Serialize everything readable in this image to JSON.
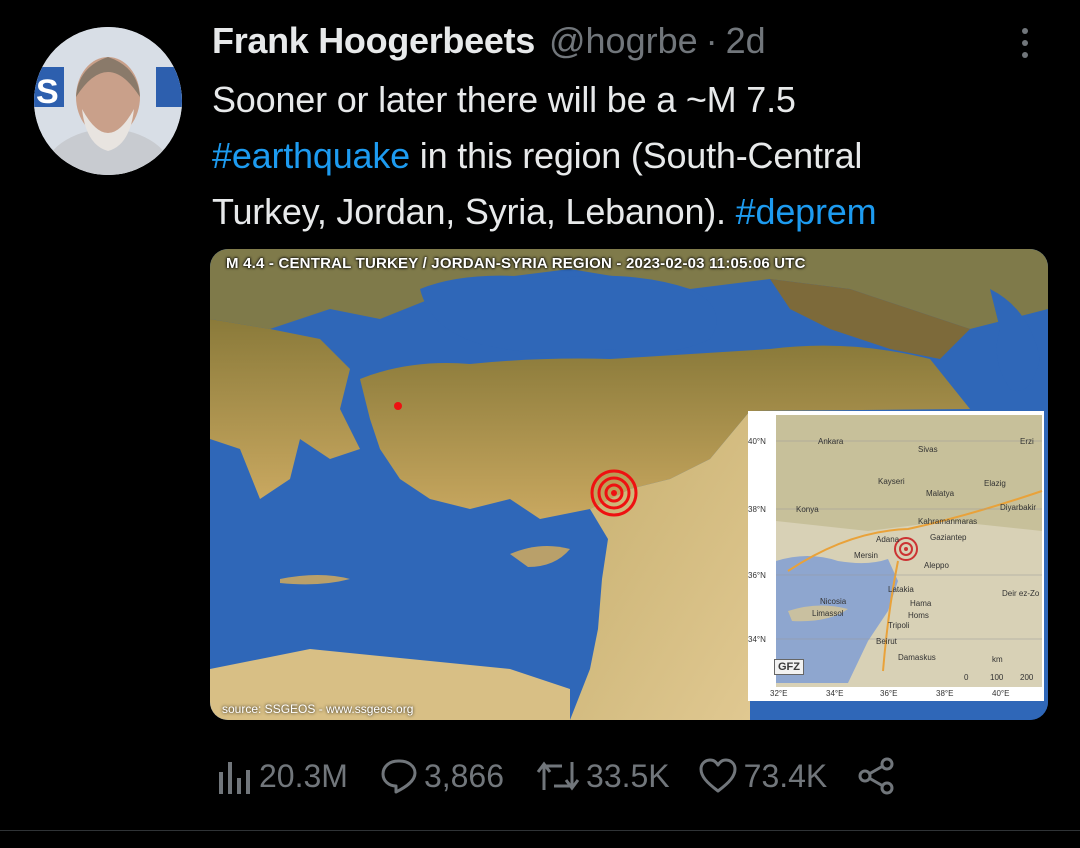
{
  "author": {
    "name": "Frank Hoogerbeets",
    "handle": "@hogrbe",
    "separator": "·",
    "time": "2d",
    "avatar_icon": "user-avatar"
  },
  "tweet": {
    "line1": "Sooner or later there will be a ~M 7.5",
    "tag_earthquake": "#earthquake",
    "line2_rest": " in this region (South-Central",
    "line3": "Turkey, Jordan, Syria, Lebanon). ",
    "tag_deprem": "#deprem"
  },
  "media": {
    "title": "M 4.4 - CENTRAL TURKEY / JORDAN-SYRIA REGION - 2023-02-03 11:05:06 UTC",
    "source": "source: SSGEOS - www.ssgeos.org",
    "inset": {
      "logo": "GFZ",
      "cities": [
        "Ankara",
        "Sivas",
        "Erzi",
        "Kayseri",
        "Malatya",
        "Elazig",
        "Konya",
        "Diyarbakir",
        "Kahramanmaras",
        "Adana",
        "Gaziantep",
        "Mersin",
        "Aleppo",
        "Latakia",
        "Deir ez-Zo",
        "Nicosia",
        "Limassol",
        "Hama",
        "Homs",
        "Tripoli",
        "Beirut",
        "Damaskus"
      ],
      "lat_labels": [
        "40°N",
        "38°N",
        "36°N",
        "34°N"
      ],
      "lon_labels": [
        "32°E",
        "34°E",
        "36°E",
        "38°E",
        "40°E"
      ],
      "scale_unit": "km",
      "scale_ticks": [
        "0",
        "100",
        "200"
      ]
    }
  },
  "actions": {
    "views": "20.3M",
    "replies": "3,866",
    "retweets": "33.5K",
    "likes": "73.4K"
  },
  "colors": {
    "accent": "#1d9bf0",
    "muted": "#71767b",
    "text": "#e7e9ea",
    "background": "#000000"
  }
}
